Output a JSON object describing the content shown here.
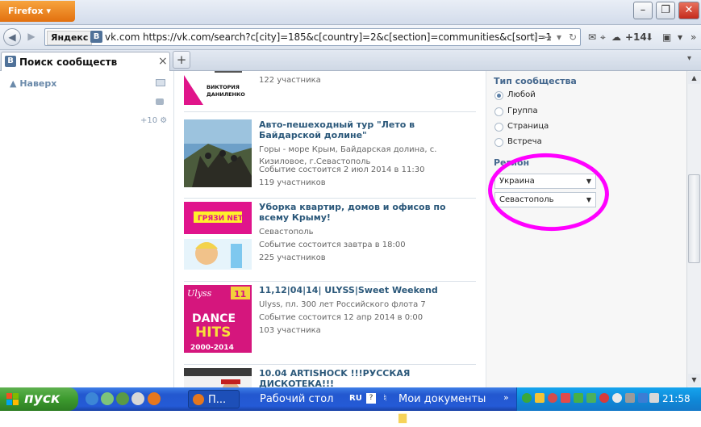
{
  "browser": {
    "menu_label": "Firefox",
    "yandex_label": "Яндекс",
    "vk_badge": "В",
    "site_domain": "vk.com",
    "url": "https://vk.com/search?c[city]=185&c[country]=2&c[section]=communities&c[sort]=1",
    "notification_count": "+14",
    "tab_title": "Поиск сообществ"
  },
  "left_menu": {
    "back_to_top": "Наверх",
    "plus_count": "+10"
  },
  "results": [
    {
      "thumb_text": "ВИКТОРИЯ ДАНИЛЕНКО",
      "title": "",
      "meta": [
        "122 участника"
      ]
    },
    {
      "title": "Авто-пешеходный тур \"Лето в Байдарской долине\"",
      "meta": [
        "Горы - море Крым, Байдарская долина, с. Кизиловое, г.Севастополь",
        "Событие состоится 2 июл 2014 в 11:30",
        "119 участников"
      ]
    },
    {
      "thumb_text": "ГРЯЗИ NET",
      "title": "Уборка квартир, домов и офисов по всему Крыму!",
      "meta": [
        "Севастополь",
        "Событие состоится завтра в 18:00",
        "225 участников"
      ]
    },
    {
      "thumb_text": "DANCE HITS 2000-2014",
      "title": "11,12|04|14| ULYSS|Sweet Weekend",
      "meta": [
        "Ulyss, пл. 300 лет Российского флота 7",
        "Событие состоится 12 апр 2014 в 0:00",
        "103 участника"
      ]
    },
    {
      "title": "10.04 ARTISHOCK !!!РУССКАЯ ДИСКОТЕКА!!!",
      "meta": []
    }
  ],
  "filters": {
    "type_heading": "Тип сообщества",
    "type_options": [
      "Любой",
      "Группа",
      "Страница",
      "Встреча"
    ],
    "selected_type": "Любой",
    "region_heading": "Регион",
    "country": "Украина",
    "city": "Севастополь"
  },
  "taskbar": {
    "start_label": "пуск",
    "firefox_btn": "П...",
    "desktop_label": "Рабочий стол",
    "lang": "RU",
    "docs_label": "Мои документы",
    "clock": "21:58"
  },
  "colors": {
    "link": "#2b587a",
    "highlight": "#ff00ff",
    "vk_blue": "#507299"
  }
}
